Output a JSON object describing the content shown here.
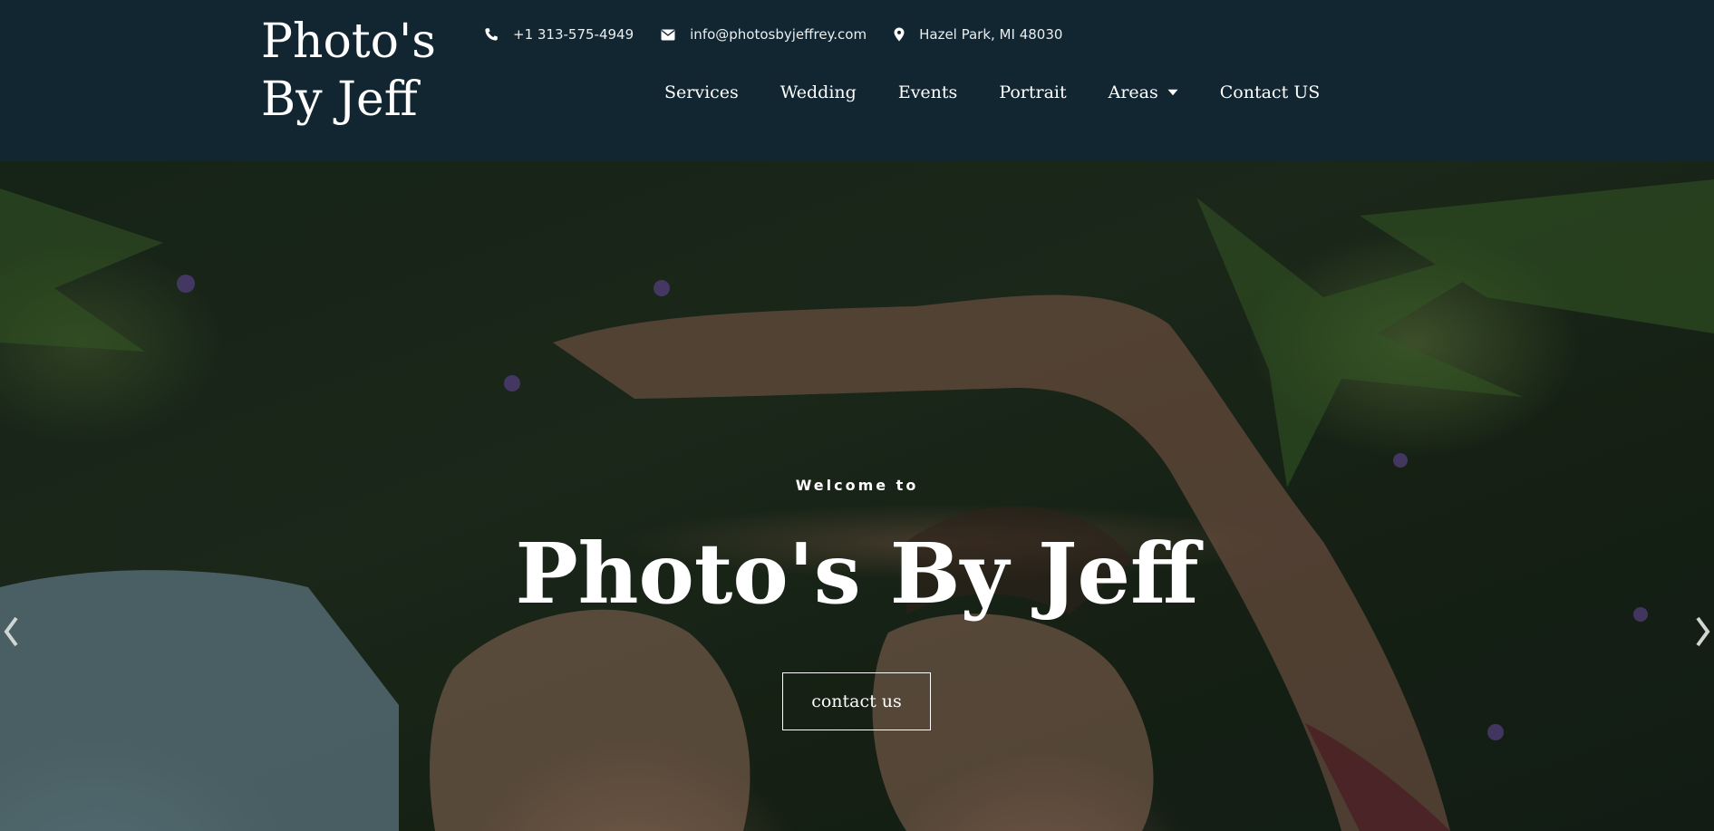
{
  "header": {
    "logo_line1": "Photo's",
    "logo_line2": "By Jeff",
    "phone": "+1 313-575-4949",
    "email": "info@photosbyjeffrey.com",
    "location": "Hazel Park, MI 48030",
    "icons": {
      "phone": "phone-icon",
      "email": "envelope-icon",
      "location": "map-pin-icon"
    }
  },
  "nav": {
    "items": [
      {
        "label": "Services"
      },
      {
        "label": "Wedding"
      },
      {
        "label": "Events"
      },
      {
        "label": "Portrait"
      },
      {
        "label": "Areas",
        "has_dropdown": true
      },
      {
        "label": "Contact US"
      }
    ]
  },
  "hero": {
    "kicker": "Welcome to",
    "title": "Photo's By Jeff",
    "cta_label": "contact us",
    "prev_icon": "chevron-left-icon",
    "next_icon": "chevron-right-icon"
  },
  "colors": {
    "header_bg": "#112631",
    "text": "#ffffff"
  }
}
